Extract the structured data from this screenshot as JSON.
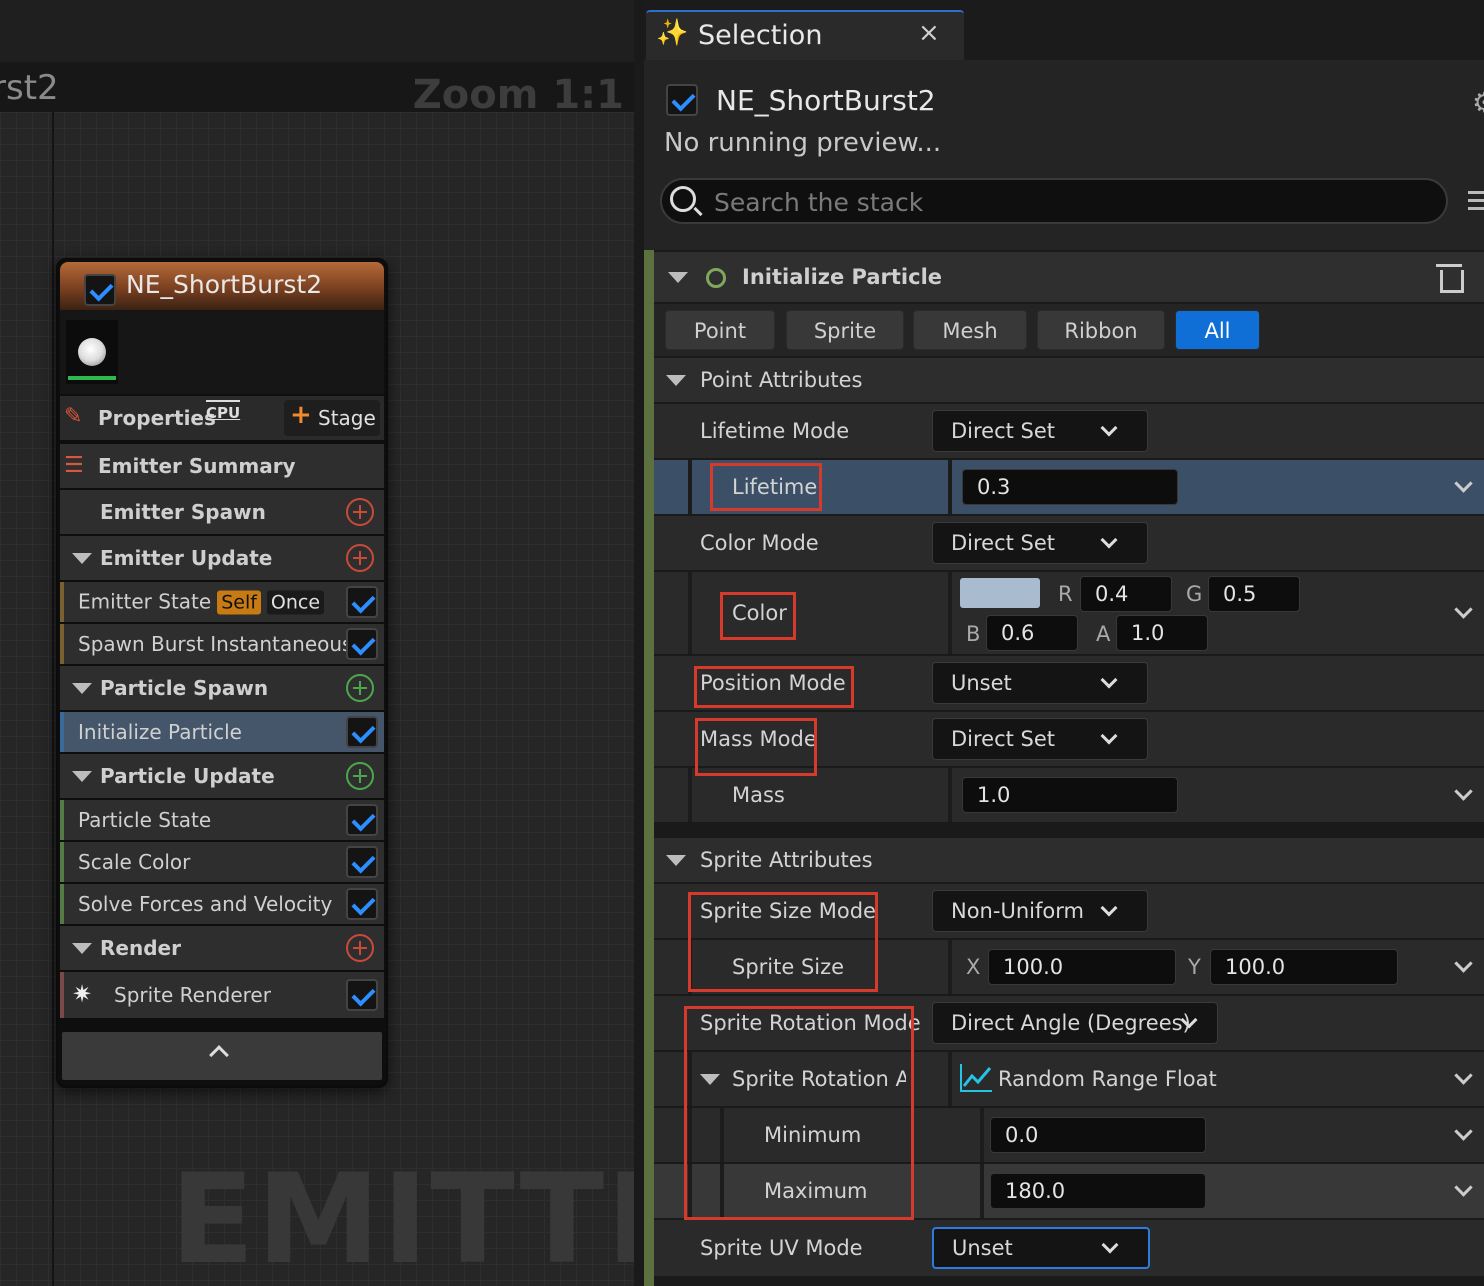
{
  "graph": {
    "title": "rst2",
    "zoom": "Zoom 1:1",
    "watermark": "EMITTER"
  },
  "node": {
    "title": "NE_ShortBurst2",
    "properties_label": "Properties",
    "cpu_label": "CPU",
    "stage_label": "Stage",
    "rows": {
      "emitter_summary": "Emitter Summary",
      "emitter_spawn": "Emitter Spawn",
      "emitter_update": "Emitter Update",
      "emitter_state": "Emitter State",
      "badge_self": "Self",
      "badge_once": "Once",
      "spawn_burst": "Spawn Burst Instantaneous",
      "particle_spawn": "Particle Spawn",
      "initialize_particle": "Initialize Particle",
      "particle_update": "Particle Update",
      "particle_state": "Particle State",
      "scale_color": "Scale Color",
      "solve_forces": "Solve Forces and Velocity",
      "render": "Render",
      "sprite_renderer": "Sprite Renderer"
    }
  },
  "panel": {
    "tab_title": "Selection",
    "tab_close": "×",
    "header_title": "NE_ShortBurst2",
    "header_sub": "No running preview...",
    "search_placeholder": "Search the stack",
    "module_title": "Initialize Particle",
    "filters": [
      "Point",
      "Sprite",
      "Mesh",
      "Ribbon",
      "All"
    ],
    "active_filter": "All",
    "point": {
      "category": "Point Attributes",
      "lifetime_mode_label": "Lifetime Mode",
      "lifetime_mode_value": "Direct Set",
      "lifetime_label": "Lifetime",
      "lifetime_value": "0.3",
      "color_mode_label": "Color Mode",
      "color_mode_value": "Direct Set",
      "color_label": "Color",
      "color_swatch": "#a9bccf",
      "r_label": "R",
      "r_value": "0.4",
      "g_label": "G",
      "g_value": "0.5",
      "b_label": "B",
      "b_value": "0.6",
      "a_label": "A",
      "a_value": "1.0",
      "position_mode_label": "Position Mode",
      "position_mode_value": "Unset",
      "mass_mode_label": "Mass Mode",
      "mass_mode_value": "Direct Set",
      "mass_label": "Mass",
      "mass_value": "1.0"
    },
    "sprite": {
      "category": "Sprite Attributes",
      "size_mode_label": "Sprite Size Mode",
      "size_mode_value": "Non-Uniform",
      "size_label": "Sprite Size",
      "x_label": "X",
      "x_value": "100.0",
      "y_label": "Y",
      "y_value": "100.0",
      "rotation_mode_label": "Sprite Rotation Mode",
      "rotation_mode_value": "Direct Angle (Degrees)",
      "rotation_angle_label": "Sprite Rotation Ang",
      "rotation_angle_value": "Random Range Float",
      "minimum_label": "Minimum",
      "minimum_value": "0.0",
      "maximum_label": "Maximum",
      "maximum_value": "180.0",
      "uv_mode_label": "Sprite UV Mode",
      "uv_mode_value": "Unset"
    }
  },
  "colors": {
    "accent_blue": "#0f6fd6",
    "highlight_red": "#d63a2a",
    "self_badge": "#c77b12"
  }
}
